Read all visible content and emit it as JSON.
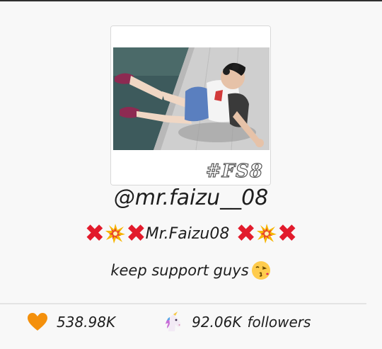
{
  "profile": {
    "handle": "@mr.faizu__08",
    "display_name_prefix_icons": [
      "cross-mark-icon",
      "collision-icon",
      "cross-mark-icon"
    ],
    "display_name": "Mr.Faizu08",
    "display_name_suffix_icons": [
      "cross-mark-icon",
      "collision-icon",
      "cross-mark-icon"
    ],
    "bio": "keep support guys",
    "bio_icon": "face-blowing-kiss-icon",
    "photo_watermark": "#FS8"
  },
  "stats": {
    "likes_icon": "orange-heart-icon",
    "likes": "538.98K",
    "followers_icon": "unicorn-icon",
    "followers": "92.06K",
    "followers_label": "followers"
  },
  "colors": {
    "cross_red": "#e21b2c",
    "heart_orange": "#f4900c",
    "text": "#1e1e1e",
    "background": "#f8f8f8"
  }
}
